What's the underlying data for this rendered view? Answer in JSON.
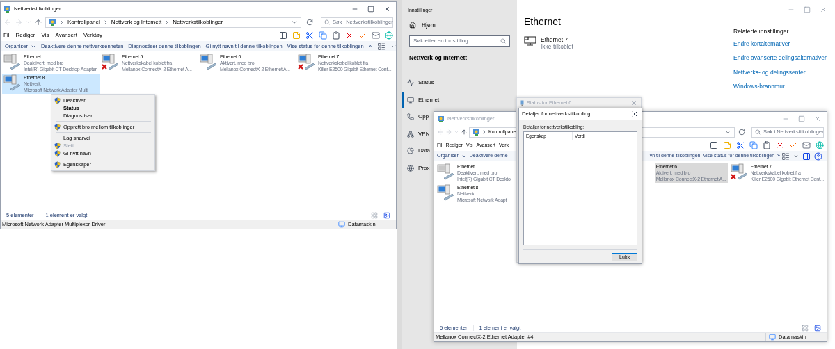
{
  "explorer_main": {
    "title": "Nettverkstilkoblinger",
    "focused": true,
    "breadcrumbs": [
      "Kontrollpanel",
      "Nettverk og Internett",
      "Nettverkstilkoblinger"
    ],
    "search": {
      "placeholder": "Søk i Nettverkstilkoblinger"
    },
    "menu": [
      "Fil",
      "Rediger",
      "Vis",
      "Avansert",
      "Verktøy"
    ],
    "commands": [
      {
        "label": "Organiser",
        "dropdown": true
      },
      {
        "label": "Deaktivere denne nettverksenheten",
        "dropdown": false
      },
      {
        "label": "Diagnostiser denne tilkoblingen",
        "dropdown": false
      },
      {
        "label": "Gi nytt navn til denne tilkoblingen",
        "dropdown": false
      },
      {
        "label": "Vise status for denne tilkoblingen",
        "dropdown": false
      },
      {
        "label": "»",
        "dropdown": false
      }
    ],
    "items": [
      {
        "name": "Ethernet",
        "status": "Deaktivert, med bro",
        "adapter": "Intel(R) Gigabit CT Desktop Adapter",
        "disabled": true,
        "unplugged": false,
        "selected": false
      },
      {
        "name": "Ethernet 5",
        "status": "Nettverkskabel koblet fra",
        "adapter": "Mellanox ConnectX-2 Ethernet A...",
        "disabled": false,
        "unplugged": true,
        "selected": false
      },
      {
        "name": "Ethernet 6",
        "status": "Aktivert, med bro",
        "adapter": "Mellanox ConnectX-2 Ethernet A...",
        "disabled": false,
        "unplugged": false,
        "selected": false
      },
      {
        "name": "Ethernet 7",
        "status": "Nettverkskabel koblet fra",
        "adapter": "Killer E2500 Gigabit Ethernet Cont...",
        "disabled": false,
        "unplugged": true,
        "selected": false
      },
      {
        "name": "Ethernet 8",
        "status": "Nettverk",
        "adapter": "Microsoft Network Adapter Multi",
        "disabled": false,
        "unplugged": false,
        "selected": true
      }
    ],
    "context_menu": [
      {
        "kind": "item",
        "label": "Deaktiver",
        "shield": true,
        "bold": false,
        "disabled": false
      },
      {
        "kind": "item",
        "label": "Status",
        "shield": false,
        "bold": true,
        "disabled": false
      },
      {
        "kind": "item",
        "label": "Diagnostiser",
        "shield": false,
        "bold": false,
        "disabled": false
      },
      {
        "kind": "separator"
      },
      {
        "kind": "item",
        "label": "Opprett bro mellom tilkoblinger",
        "shield": true,
        "bold": false,
        "disabled": false
      },
      {
        "kind": "separator"
      },
      {
        "kind": "item",
        "label": "Lag snarvei",
        "shield": false,
        "bold": false,
        "disabled": false
      },
      {
        "kind": "item",
        "label": "Slett",
        "shield": true,
        "bold": false,
        "disabled": true
      },
      {
        "kind": "item",
        "label": "Gi nytt navn",
        "shield": true,
        "bold": false,
        "disabled": false
      },
      {
        "kind": "separator"
      },
      {
        "kind": "item",
        "label": "Egenskaper",
        "shield": true,
        "bold": false,
        "disabled": false
      }
    ],
    "count": "5 elementer",
    "selection": "1 element er valgt",
    "details": "Microsoft Network Adapter Multiplexor Driver",
    "location": "Datamaskin"
  },
  "settings": {
    "title": "Innstillinger",
    "home": "Hjem",
    "search": {
      "placeholder": "Søk etter en innstilling"
    },
    "section": "Nettverk og Internett",
    "nav": [
      {
        "label": "Status",
        "kind": "status",
        "selected": false
      },
      {
        "label": "Ethernet",
        "kind": "ethernet",
        "selected": true
      },
      {
        "label": "Opp",
        "kind": "dialup",
        "selected": false
      },
      {
        "label": "VPN",
        "kind": "vpn",
        "selected": false
      },
      {
        "label": "Data",
        "kind": "data",
        "selected": false
      },
      {
        "label": "Prox",
        "kind": "proxy",
        "selected": false
      }
    ],
    "heading": "Ethernet",
    "connection": {
      "name": "Ethernet 7",
      "status": "Ikke tilkoblet"
    },
    "related": {
      "heading": "Relaterte innstillinger",
      "links": [
        "Endre kortalternativer",
        "Endre avanserte delingsalternativer",
        "Nettverks- og delingssenter",
        "Windows-brannmur"
      ]
    }
  },
  "explorer_second": {
    "title": "Nettverkstilkoblinger",
    "focused": false,
    "breadcrumbs": [
      "Kontrollpanel"
    ],
    "search": {
      "placeholder": "Søk i Nettverkstilkoblinger"
    },
    "menu": [
      "Fil",
      "Rediger",
      "Vis",
      "Avansert",
      "Verk"
    ],
    "commands_left": [
      {
        "label": "Organiser",
        "dropdown": true
      },
      {
        "label": "Deaktivere denne",
        "dropdown": false
      }
    ],
    "commands_right": [
      {
        "label": "vn til denne tilkoblingen",
        "dropdown": false
      },
      {
        "label": "Vise status for denne tilkoblingen",
        "dropdown": false
      },
      {
        "label": "»",
        "dropdown": false
      }
    ],
    "items_left": [
      {
        "name": "Ethernet",
        "status": "Deaktivert, med bro",
        "adapter": "Intel(R) Gigabit CT Deskto",
        "disabled": true,
        "unplugged": false,
        "selected": false,
        "icon_covered": false
      },
      {
        "name": "Ethernet 8",
        "status": "Nettverk",
        "adapter": "Microsoft Network Adapt",
        "disabled": false,
        "unplugged": false,
        "selected": false,
        "icon_covered": false
      }
    ],
    "items_right": [
      {
        "name": "Ethernet 6",
        "status": "Aktivert, med bro",
        "adapter": "Mellanox ConnectX-2 Ethernet A...",
        "selected": true,
        "icon_covered": true
      },
      {
        "name": "Ethernet 7",
        "status": "Nettverkskabel koblet fra",
        "adapter": "Killer E2500 Gigabit Ethernet Cont...",
        "disabled": false,
        "unplugged": true,
        "selected": false,
        "icon_covered": false
      }
    ],
    "count": "5 elementer",
    "selection": "1 element er valgt",
    "details": "Mellanox ConnectX-2 Ethernet Adapter #4",
    "location": "Datamaskin"
  },
  "status_dialog": {
    "title": "Status for Ethernet 6"
  },
  "details_dialog": {
    "title": "Detaljer for nettverkstilkobling",
    "label": "Detaljer for nettverkstilkobling:",
    "columns": [
      "Egenskap",
      "Verdi"
    ],
    "button": "Lukk"
  }
}
